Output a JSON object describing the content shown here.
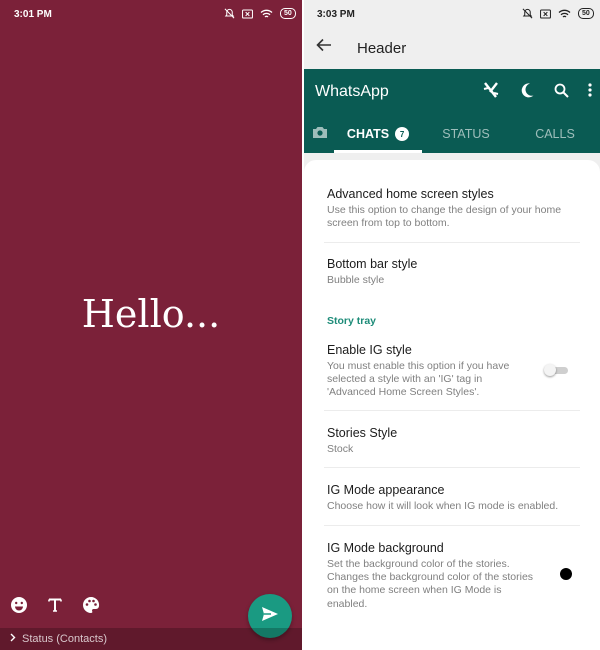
{
  "left_screen": {
    "status_bar": {
      "time": "3:01 PM",
      "battery": "50"
    },
    "status_text": "Hello...",
    "bottom_bar": {
      "label": "Status (Contacts)"
    },
    "colors": {
      "background": "#7b2139",
      "send_button": "#1a9a82"
    },
    "icons": [
      "emoji-icon",
      "text-icon",
      "palette-icon",
      "send-icon",
      "chevron-right-icon"
    ]
  },
  "right_screen": {
    "status_bar": {
      "time": "3:03 PM",
      "battery": "50"
    },
    "header": {
      "title": "Header"
    },
    "whatsapp_bar": {
      "title": "WhatsApp",
      "color": "#0a5b53",
      "icons": [
        "crossed-arrows-icon",
        "moon-icon",
        "search-icon",
        "more-vert-icon"
      ],
      "tabs": {
        "chats": {
          "label": "CHATS",
          "badge": "7"
        },
        "status": {
          "label": "STATUS"
        },
        "calls": {
          "label": "CALLS"
        }
      }
    },
    "settings": {
      "advanced_home": {
        "title": "Advanced home screen styles",
        "subtitle": "Use this option to change the design of your home screen from top to bottom."
      },
      "bottom_bar": {
        "title": "Bottom bar style",
        "subtitle": "Bubble style"
      },
      "section_story_tray": "Story tray",
      "enable_ig": {
        "title": "Enable IG style",
        "subtitle": "You must enable this option if you have selected a style with an 'IG' tag in 'Advanced Home Screen Styles'.",
        "enabled": false
      },
      "stories_style": {
        "title": "Stories Style",
        "subtitle": "Stock"
      },
      "ig_appearance": {
        "title": "IG Mode appearance",
        "subtitle": "Choose how it will look when IG mode is enabled."
      },
      "ig_background": {
        "title": "IG Mode background",
        "subtitle": "Set the background color of the stories. Changes the background color of the stories on the home screen when IG Mode is enabled.",
        "color": "#000000"
      }
    }
  }
}
